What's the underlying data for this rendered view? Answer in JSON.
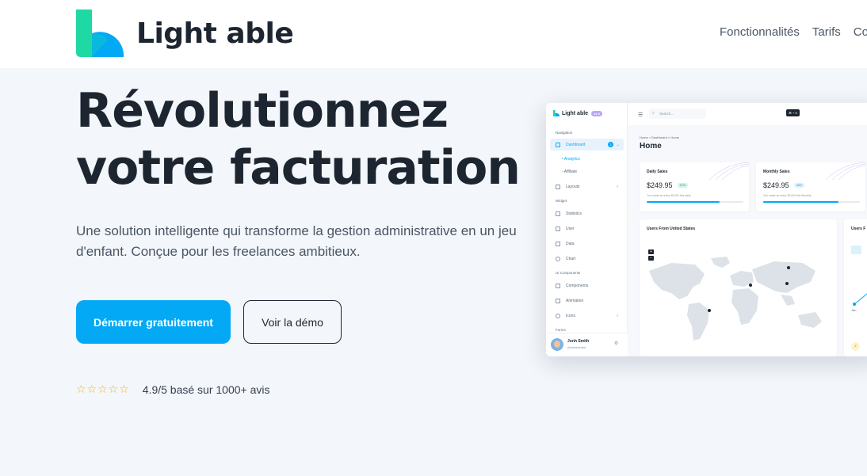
{
  "brand": {
    "name": "Light able",
    "colors": {
      "primary": "#04a9f5",
      "mint": "#1fd9a4",
      "text": "#1d2630"
    }
  },
  "nav": {
    "items": [
      "Fonctionnalités",
      "Tarifs",
      "Co"
    ]
  },
  "hero": {
    "title_line1": "Révolutionnez",
    "title_line2": "votre facturation",
    "subtitle": "Une solution intelligente qui transforme la gestion administrative en un jeu d'enfant. Conçue pour les freelances ambitieux.",
    "primary_cta": "Démarrer gratuitement",
    "secondary_cta": "Voir la démo",
    "stars": "☆☆☆☆☆",
    "rating_text": "4.9/5 basé sur 1000+ avis"
  },
  "dashboard": {
    "logo": "Light able",
    "version_pill": "v1.0",
    "search_placeholder": "Search...",
    "shortcut": "⌘ + K",
    "sections": {
      "navigation": "Navigation",
      "widget": "Widget",
      "ui": "UI Components",
      "forms": "Forms"
    },
    "sidebar": {
      "dashboard": "Dashboard",
      "dashboard_badge": "2",
      "analytics": "Analytics",
      "affiliate": "Affiliate",
      "layouts": "Layouts",
      "statistics": "Statistics",
      "user": "User",
      "data": "Data",
      "chart": "Chart",
      "components": "Components",
      "animation": "Animation",
      "icons": "Icons"
    },
    "user": {
      "name": "Jonh Smith",
      "role": "Administrator"
    },
    "breadcrumb": "Home  >  Dashboard  >  Home",
    "page_title": "Home",
    "daily": {
      "title": "Daily Sales",
      "value": "$249.95",
      "pct": "67%",
      "note": "You made an extra 35,000 this daily",
      "progress": 0.75
    },
    "monthly": {
      "title": "Monthly Sales",
      "value": "$249.95",
      "pct": "36%",
      "note": "You made an extra 35,000 this Monthly",
      "progress": 0.78
    },
    "map_title": "Users From United States",
    "right_card_title": "Users F",
    "zoom_in": "+",
    "zoom_out": "−",
    "chart_x_label": "Jan"
  }
}
